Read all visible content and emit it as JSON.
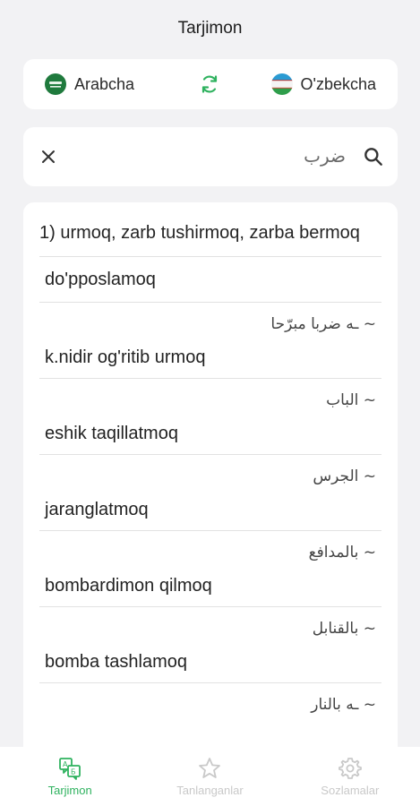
{
  "header": {
    "title": "Tarjimon"
  },
  "language_bar": {
    "source": {
      "label": "Arabcha",
      "flag_icon": "saudi-arabia-flag-icon"
    },
    "target": {
      "label": "O'zbekcha",
      "flag_icon": "uzbekistan-flag-icon"
    },
    "swap_icon": "swap-refresh-icon",
    "accent": "#2fb25f"
  },
  "search": {
    "query": "ضرب",
    "clear_icon": "close-icon",
    "search_icon": "search-icon"
  },
  "results": {
    "main": "1) urmoq, zarb tushirmoq, zarba bermoq",
    "rows": [
      {
        "ar": "",
        "uz": "do'pposlamoq"
      },
      {
        "ar": "~ ـه ضربا مبرّحا",
        "uz": "k.nidir og'ritib urmoq"
      },
      {
        "ar": "~ الباب",
        "uz": "eshik taqillatmoq"
      },
      {
        "ar": "~ الجرس",
        "uz": "jaranglatmoq"
      },
      {
        "ar": "~ بالمدافع",
        "uz": "bombardimon qilmoq"
      },
      {
        "ar": "~ بالقنابل",
        "uz": "bomba tashlamoq"
      },
      {
        "ar": "~ ـه بالنار",
        "uz": ""
      }
    ]
  },
  "bottom_nav": [
    {
      "label": "Tarjimon",
      "icon": "translate-icon",
      "active": true
    },
    {
      "label": "Tanlanganlar",
      "icon": "star-icon",
      "active": false
    },
    {
      "label": "Sozlamalar",
      "icon": "gear-icon",
      "active": false
    }
  ]
}
